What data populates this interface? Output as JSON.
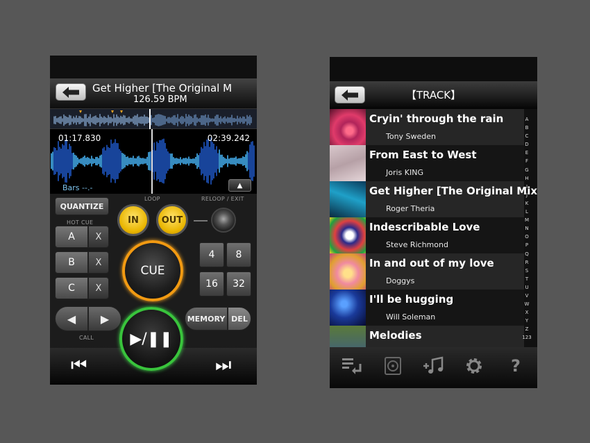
{
  "deck": {
    "title": "Get Higher [The Original Mi",
    "bpm": "126.59 BPM",
    "time_elapsed": "01:17.830",
    "time_remaining": "02:39.242",
    "bars": "Bars --.-",
    "quantize": "QUANTIZE",
    "loop_label": "LOOP",
    "reloop_label": "RELOOP / EXIT",
    "loop_in": "IN",
    "loop_out": "OUT",
    "hot_cue_label": "HOT CUE",
    "hot_cues": [
      "A",
      "B",
      "C"
    ],
    "hot_cue_delete": "X",
    "cue": "CUE",
    "call_label": "CALL",
    "call_prev": "◀",
    "call_next": "▶",
    "loop_lengths": [
      "4",
      "8",
      "16",
      "32"
    ],
    "memory": "MEMORY",
    "delete": "DEL",
    "play_pause": "▶/❚❚",
    "prev_track": "⏮",
    "next_track": "⏭",
    "up_arrow": "▲",
    "icons": [
      "back-arrow-icon",
      "skip-back-icon",
      "skip-forward-icon"
    ],
    "colors": {
      "play": "#39c43c",
      "cue": "#f29a12",
      "loop": "#e9b500",
      "wave": "#3a8dde"
    }
  },
  "library": {
    "title": "【TRACK】",
    "tracks": [
      {
        "name": "Cryin' through the rain",
        "artist": "Tony Sweden"
      },
      {
        "name": "From East to West",
        "artist": "Joris KING"
      },
      {
        "name": "Get Higher [The Original Mix]",
        "artist": "Roger Theria"
      },
      {
        "name": "Indescribable Love",
        "artist": "Steve Richmond"
      },
      {
        "name": "In and out of my love",
        "artist": "Doggys"
      },
      {
        "name": "I'll be hugging",
        "artist": "Will Soleman"
      },
      {
        "name": "Melodies",
        "artist": ""
      }
    ],
    "index": [
      "A",
      "B",
      "C",
      "D",
      "E",
      "F",
      "G",
      "H",
      "I",
      "J",
      "K",
      "L",
      "M",
      "N",
      "O",
      "P",
      "Q",
      "R",
      "S",
      "T",
      "U",
      "V",
      "W",
      "X",
      "Y",
      "Z",
      "123"
    ],
    "footer_icons": [
      "list-back-icon",
      "disc-icon",
      "add-music-icon",
      "gear-icon",
      "help-icon"
    ]
  }
}
